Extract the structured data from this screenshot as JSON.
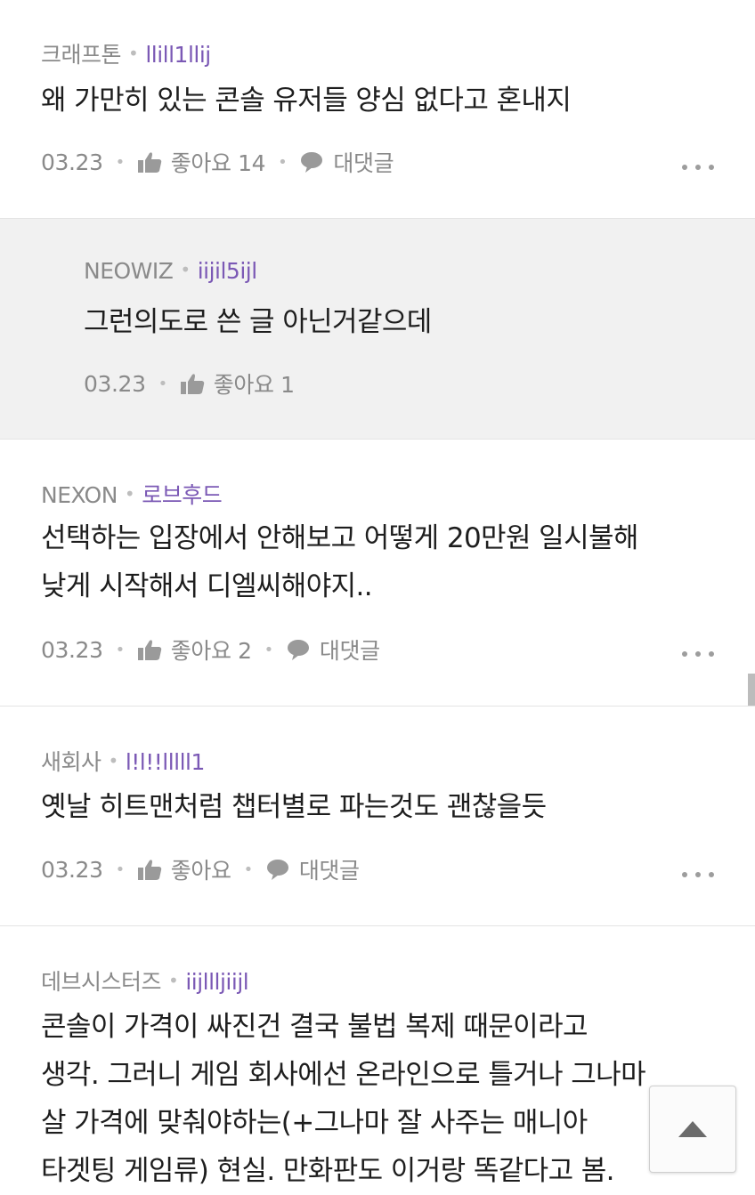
{
  "comments": [
    {
      "company": "크래프톤",
      "nickname": "llill1llij",
      "lines": [
        "왜 가만히 있는 콘솔 유저들 양심 없다고 혼내지"
      ],
      "date": "03.23",
      "likes": "좋아요 14",
      "reply_label": "대댓글"
    },
    {
      "company": "NEOWIZ",
      "nickname": "iijil5ijl",
      "lines": [
        "그런의도로 쓴 글 아닌거같으데"
      ],
      "date": "03.23",
      "likes": "좋아요 1"
    },
    {
      "company": "NEXON",
      "nickname": "로브후드",
      "lines": [
        "선택하는 입장에서 안해보고 어떻게 20만원 일시불해",
        "낮게 시작해서 디엘씨해야지.."
      ],
      "date": "03.23",
      "likes": "좋아요 2",
      "reply_label": "대댓글"
    },
    {
      "company": "새회사",
      "nickname": "l!l!!lllll1",
      "lines": [
        "옛날 히트맨처럼 챕터별로 파는것도 괜찮을듯"
      ],
      "date": "03.23",
      "likes": "좋아요",
      "reply_label": "대댓글"
    },
    {
      "company": "데브시스터즈",
      "nickname": "iijllljiijl",
      "lines": [
        "콘솔이 가격이 싸진건 결국 불법 복제 때문이라고",
        "생각. 그러니 게임 회사에선 온라인으로 틀거나 그나마",
        "살 가격에 맞춰야하는(+그나마 잘 사주는 매니아",
        "타겟팅 게임류) 현실. 만화판도 이거랑 똑같다고 봄."
      ]
    }
  ],
  "icons": {
    "like": "thumbs-up-icon",
    "reply": "speech-bubble-icon",
    "more": "more-dots-icon",
    "scroll_top": "triangle-up-icon"
  },
  "colors": {
    "nickname": "#7b59b5",
    "meta": "#8a8a8a",
    "text": "#1e1e1e",
    "reply_bg": "#f1f1f1"
  }
}
